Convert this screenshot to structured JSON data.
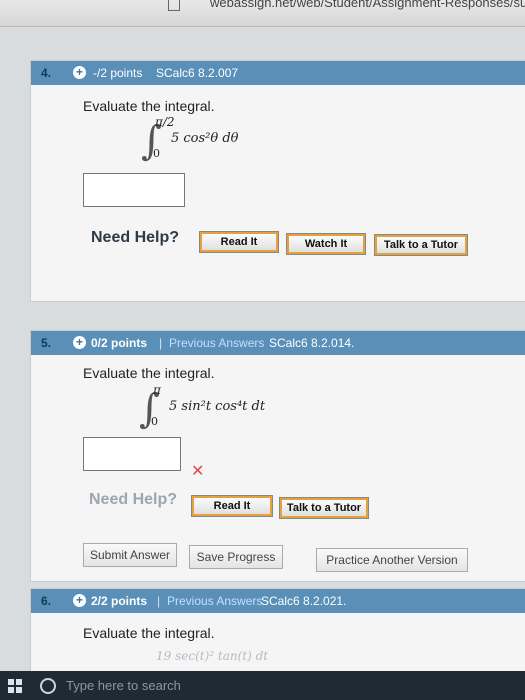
{
  "browser": {
    "url": "webassign.net/web/Student/Assignment-Responses/sub"
  },
  "questions": [
    {
      "number": "4.",
      "points": "-/2 points",
      "separator": "",
      "previous_answers": "",
      "code": "SCalc6 8.2.007",
      "prompt": "Evaluate the integral.",
      "integral_upper": "π/2",
      "integral_lower": "0",
      "integrand": "5 cos²θ dθ",
      "help_label": "Need Help?",
      "buttons": [
        "Read It",
        "Watch It",
        "Talk to a Tutor"
      ]
    },
    {
      "number": "5.",
      "points": "0/2 points",
      "separator": "|",
      "previous_answers": "Previous Answers",
      "code": "SCalc6 8.2.014.",
      "prompt": "Evaluate the integral.",
      "integral_upper": "π",
      "integral_lower": "0",
      "integrand": "5 sin²t cos⁴t dt",
      "answer_mark": "✕",
      "help_label": "Need Help?",
      "buttons": [
        "Read It",
        "Talk to a Tutor"
      ],
      "actions": [
        "Submit Answer",
        "Save Progress",
        "Practice Another Version"
      ]
    },
    {
      "number": "6.",
      "points": "2/2 points",
      "separator": "|",
      "previous_answers": "Previous Answers",
      "code": "SCalc6 8.2.021.",
      "prompt": "Evaluate the integral.",
      "integrand_partial": "19 sec(t)² tan(t) dt"
    }
  ],
  "taskbar": {
    "search_placeholder": "Type here to search"
  }
}
